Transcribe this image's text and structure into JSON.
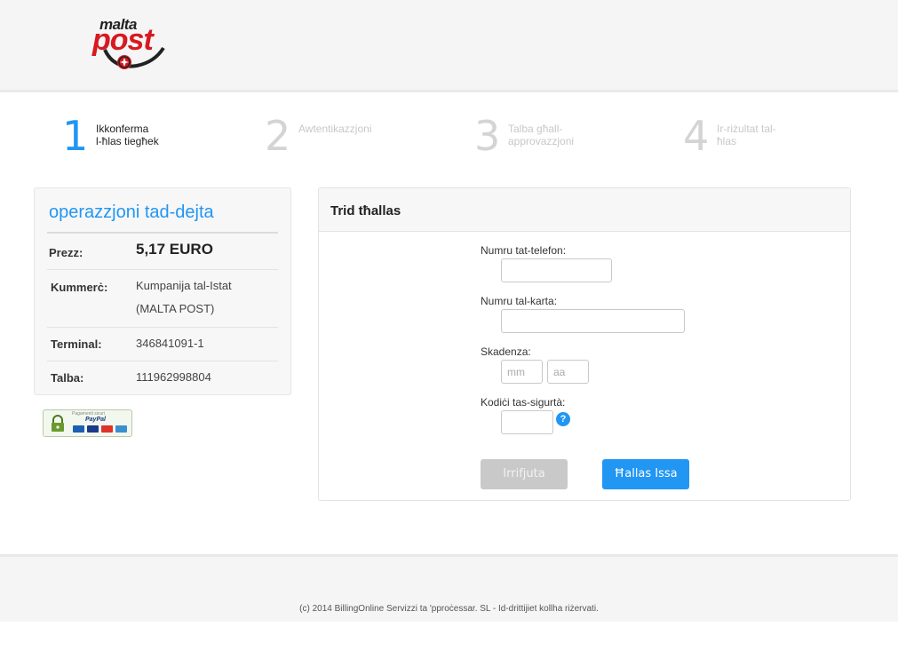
{
  "header": {
    "logo_small": "malta",
    "logo_big": "post"
  },
  "steps": [
    {
      "number": "1",
      "label_line1": "Ikkonferma",
      "label_line2": "l-ħlas tiegħek",
      "active": true
    },
    {
      "number": "2",
      "label_line1": "Awtentikazzjoni",
      "label_line2": "",
      "active": false
    },
    {
      "number": "3",
      "label_line1": "Talba għall-",
      "label_line2": "approvazzjoni",
      "active": false
    },
    {
      "number": "4",
      "label_line1": "Ir-riżultat tal-",
      "label_line2": "ħlas",
      "active": false
    }
  ],
  "summary": {
    "title": "operazzjoni tad-dejta",
    "price_label": "Prezz:",
    "price_value": "5,17 EURO",
    "merchant_label": "Kummerċ:",
    "merchant_line1": "Kumpanija tal-Istat",
    "merchant_line2": "(MALTA POST)",
    "terminal_label": "Terminal:",
    "terminal_value": "346841091-1",
    "order_label": "Talba:",
    "order_value": "111962998804"
  },
  "badge": {
    "caption": "Pagamenti sicuri",
    "brand": "PayPal"
  },
  "payment": {
    "title": "Trid tħallas",
    "phone_label": "Numru tat-telefon:",
    "phone_value": "",
    "card_label": "Numru tal-karta:",
    "card_value": "",
    "expiry_label": "Skadenza:",
    "month_placeholder": "mm",
    "year_placeholder": "aa",
    "cvv_label": "Kodiċi tas-sigurtà:",
    "cvv_value": "",
    "help_glyph": "?",
    "cancel_label": "Irrifjuta",
    "pay_label": "Ħallas Issa"
  },
  "footer": {
    "text": "(c) 2014 BillingOnline Servizzi ta 'pproċessar. SL - Id-drittijiet kollha riżervati."
  },
  "colors": {
    "accent": "#2196f3",
    "brand_red": "#d71920"
  }
}
